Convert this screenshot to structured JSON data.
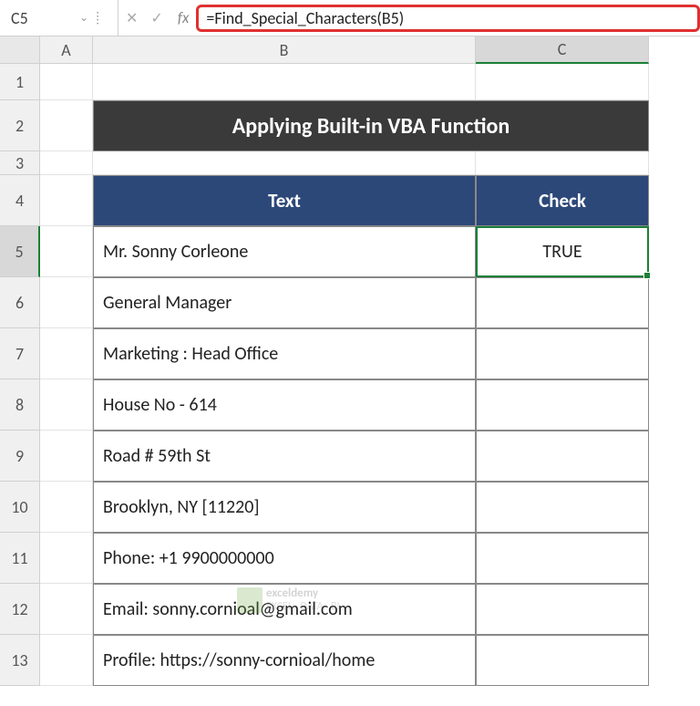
{
  "nameBox": "C5",
  "formula": "=Find_Special_Characters(B5)",
  "columns": {
    "a": "A",
    "b": "B",
    "c": "C"
  },
  "rowNumbers": [
    "1",
    "2",
    "3",
    "4",
    "5",
    "6",
    "7",
    "8",
    "9",
    "10",
    "11",
    "12",
    "13"
  ],
  "title": "Applying Built-in VBA Function",
  "headers": {
    "text": "Text",
    "check": "Check"
  },
  "data": [
    {
      "text": "Mr. Sonny Corleone",
      "check": "TRUE"
    },
    {
      "text": "General Manager",
      "check": ""
    },
    {
      "text": "Marketing : Head Office",
      "check": ""
    },
    {
      "text": "House No - 614",
      "check": ""
    },
    {
      "text": "Road # 59th St",
      "check": ""
    },
    {
      "text": "Brooklyn, NY [11220]",
      "check": ""
    },
    {
      "text": "Phone: +1 9900000000",
      "check": ""
    },
    {
      "text": "Email: sonny.cornioal@gmail.com",
      "check": ""
    },
    {
      "text": "Profile: https://sonny-cornioal/home",
      "check": ""
    }
  ],
  "watermark": {
    "brand": "exceldemy",
    "tagline": "EXCEL · DATA · BI"
  }
}
